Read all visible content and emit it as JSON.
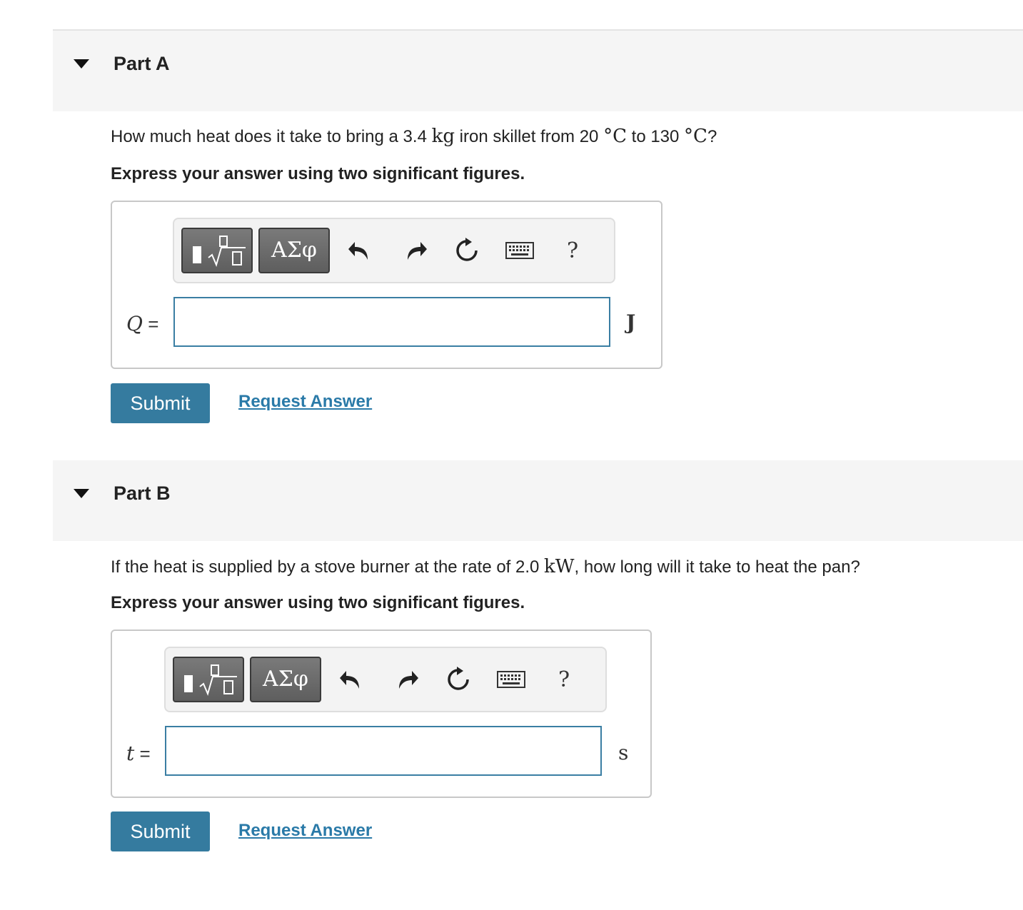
{
  "parts": [
    {
      "title": "Part A",
      "question": {
        "pre": "How much heat does it take to bring a 3.4 ",
        "unit1": "kg",
        "mid": " iron skillet from 20 ",
        "deg1": "°C",
        "mid2": " to 130 ",
        "deg2": "°C",
        "post": "?"
      },
      "instruction": "Express your answer using two significant figures.",
      "toolbar": {
        "greek_label": "ΑΣφ",
        "help_label": "?"
      },
      "variable": "Q",
      "equals": " =",
      "input_value": "",
      "unit": "J",
      "submit_label": "Submit",
      "request_label": "Request Answer"
    },
    {
      "title": "Part B",
      "question": {
        "pre": "If the heat is supplied by a stove burner at the rate of 2.0 ",
        "unit1": "kW",
        "post": ", how long will it take to heat the pan?"
      },
      "instruction": "Express your answer using two significant figures.",
      "toolbar": {
        "greek_label": "ΑΣφ",
        "help_label": "?"
      },
      "variable": "t",
      "equals": " =",
      "input_value": "",
      "unit": "s",
      "submit_label": "Submit",
      "request_label": "Request Answer"
    }
  ]
}
